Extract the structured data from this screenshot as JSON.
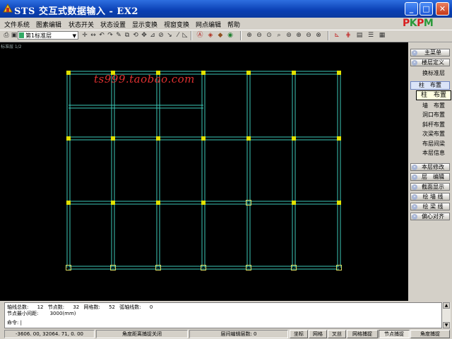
{
  "window": {
    "title": "STS 交互式数据输入 - EX2",
    "controls": {
      "minimize": "_",
      "maximize": "□",
      "close": "✕"
    }
  },
  "menu": [
    "文件系统",
    "图素编辑",
    "状态开关",
    "状态设置",
    "显示变换",
    "视窗变换",
    "网点编辑",
    "帮助"
  ],
  "logo": {
    "text": "PKPM",
    "colors": [
      "#d81e1e",
      "#2a9a3a"
    ]
  },
  "toolbar": {
    "layer_select_value": "第1标准层",
    "icons": [
      "print-icon",
      "save-icon",
      "layer-select",
      "cursor-icon",
      "move-icon",
      "undo-icon",
      "redo-icon",
      "delete-icon",
      "copy-icon",
      "rotate-icon",
      "mirror-icon",
      "break-icon",
      "extend-icon",
      "line-icon",
      "point-icon",
      "3d-view-icon",
      "render-icon",
      "layer-icon",
      "zoom-icons",
      "snap-icons"
    ]
  },
  "canvas": {
    "corner_label": "标准层 1/2",
    "watermark": "ts999.taobao.com",
    "grid_color": "#3cc8b8",
    "column_color": "#e0e000",
    "background": "#000000"
  },
  "right_panel": {
    "main_menu": "主菜单",
    "floor_def": "楼层定义",
    "items": [
      "换标准层",
      "柱　布置",
      "墙　布置",
      "洞口布置",
      "斜杆布置",
      "次梁布置",
      "布层间梁",
      "本层信息"
    ],
    "active_item": "柱　布置",
    "tooltip": "柱　布置",
    "lower_buttons": [
      "本层修改",
      "层　编辑",
      "截面显示",
      "绘 墙 线",
      "绘 梁 线",
      "偏心对齐"
    ]
  },
  "command": {
    "line1_label1": "轴线总数:",
    "line1_val1": "12",
    "line1_label2": "节点数:",
    "line1_val2": "32",
    "line1_label3": "网格数:",
    "line1_val3": "52",
    "line1_label4": "弧轴线数:",
    "line1_val4": "0",
    "line2_label": "节点最小间距:",
    "line2_val": "3000(mm)",
    "prompt": "命令: |"
  },
  "status": {
    "coords": "-3606. 00, 32064. 71, 0. 00",
    "angle_snap": "角度距离捕捉关闭",
    "layer_count": "层间编辑层数:  0",
    "buttons": [
      "坐标",
      "网格",
      "叉丝",
      "网格捕捉",
      "节点捕捉",
      "角度捕捉"
    ],
    "pressed": "节点捕捉"
  }
}
